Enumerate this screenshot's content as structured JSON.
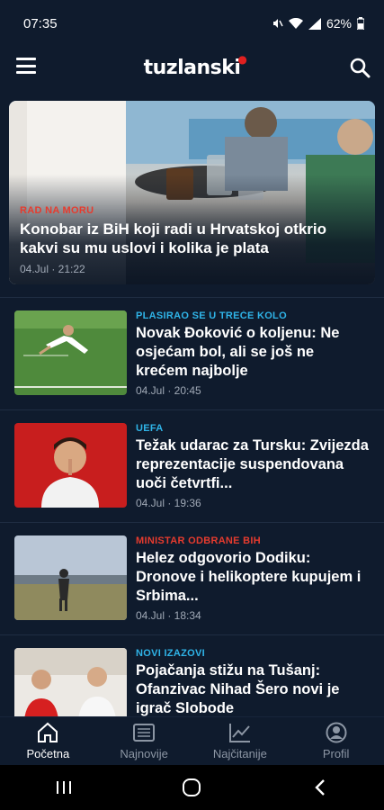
{
  "status": {
    "time": "07:35",
    "battery": "62%"
  },
  "app": {
    "logo": "tuzlanski",
    "logo_mark": "⁰"
  },
  "hero": {
    "category": "RAD NA MORU",
    "title": "Konobar iz BiH koji radi u Hrvatskoj otkrio kakvi su mu uslovi i kolika je plata",
    "date": "04.Jul · 21:22"
  },
  "articles": [
    {
      "category": "PLASIRAO SE U TREĆE KOLO",
      "category_color": "#2fb4e8",
      "title": "Novak Đoković o koljenu: Ne osjećam bol, ali se još ne krećem najbolje",
      "date": "04.Jul · 20:45",
      "thumb": "tennis"
    },
    {
      "category": "UEFA",
      "category_color": "#2fb4e8",
      "title": "Težak udarac za Tursku: Zvijezda reprezentacije suspendovana uoči četvrtfi...",
      "date": "04.Jul · 19:36",
      "thumb": "football-player"
    },
    {
      "category": "MINISTAR ODBRANE BIH",
      "category_color": "#e63b2e",
      "title": "Helez odgovorio Dodiku: Dronove i helikoptere kupujem i Srbima...",
      "date": "04.Jul · 18:34",
      "thumb": "field-person"
    },
    {
      "category": "NOVI IZAZOVI",
      "category_color": "#2fb4e8",
      "title": "Pojačanja stižu na Tušanj: Ofanzivac Nihad Šero novi je igrač Slobode",
      "date": "",
      "thumb": "press"
    }
  ],
  "nav": [
    {
      "label": "Početna",
      "icon": "home-icon",
      "active": true
    },
    {
      "label": "Najnovije",
      "icon": "news-icon",
      "active": false
    },
    {
      "label": "Najčitanije",
      "icon": "trending-icon",
      "active": false
    },
    {
      "label": "Profil",
      "icon": "profile-icon",
      "active": false
    }
  ],
  "colors": {
    "background": "#0f1b2d",
    "accent_red": "#e63b2e",
    "accent_blue": "#2fb4e8"
  }
}
